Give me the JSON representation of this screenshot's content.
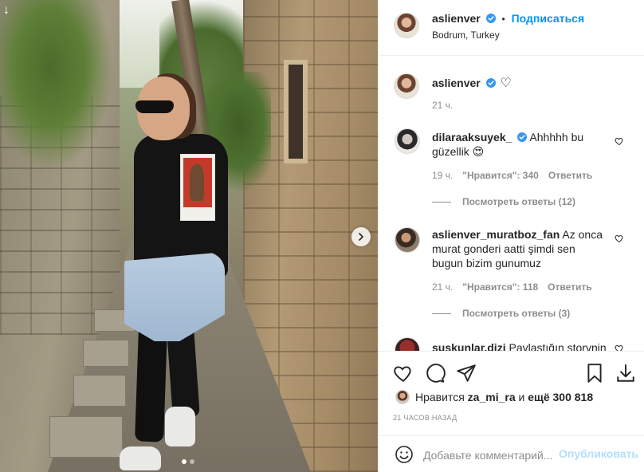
{
  "header": {
    "username": "aslienver",
    "follow_label": "Подписаться",
    "location": "Bodrum, Turkey"
  },
  "caption": {
    "username": "aslienver",
    "emoji": "♡",
    "time": "21 ч."
  },
  "comments": [
    {
      "username": "dilaraaksuyek_",
      "verified": true,
      "text": "Ahhhhh bu güzellik",
      "emoji": "😍",
      "time": "19 ч.",
      "likes": "\"Нравится\": 340",
      "reply_label": "Ответить",
      "view_replies": "Посмотреть ответы (12)"
    },
    {
      "username": "aslienver_muratboz_fan",
      "verified": false,
      "text": "Az onca murat gonderi aatti şimdi sen bugun bizim gunumuz",
      "time": "21 ч.",
      "likes": "\"Нравится\": 118",
      "reply_label": "Ответить",
      "view_replies": "Посмотреть ответы (3)"
    },
    {
      "username": "suskunlar.dizi",
      "verified": false,
      "text": "Paylaştığın storynin"
    }
  ],
  "likes": {
    "prefix": "Нравится",
    "user": "za_mi_ra",
    "conjunction": "и",
    "others": "ещё 300 818"
  },
  "timestamp": "21 ЧАСОВ НАЗАД",
  "comment_box": {
    "placeholder": "Добавьте комментарий...",
    "post_label": "Опубликовать"
  },
  "colors": {
    "accent": "#0095f6",
    "post_disabled": "#b2dffc",
    "secondary_text": "#8e8e8e",
    "border": "#efefef"
  },
  "carousel": {
    "total_slides": 2,
    "active_slide": 1
  }
}
